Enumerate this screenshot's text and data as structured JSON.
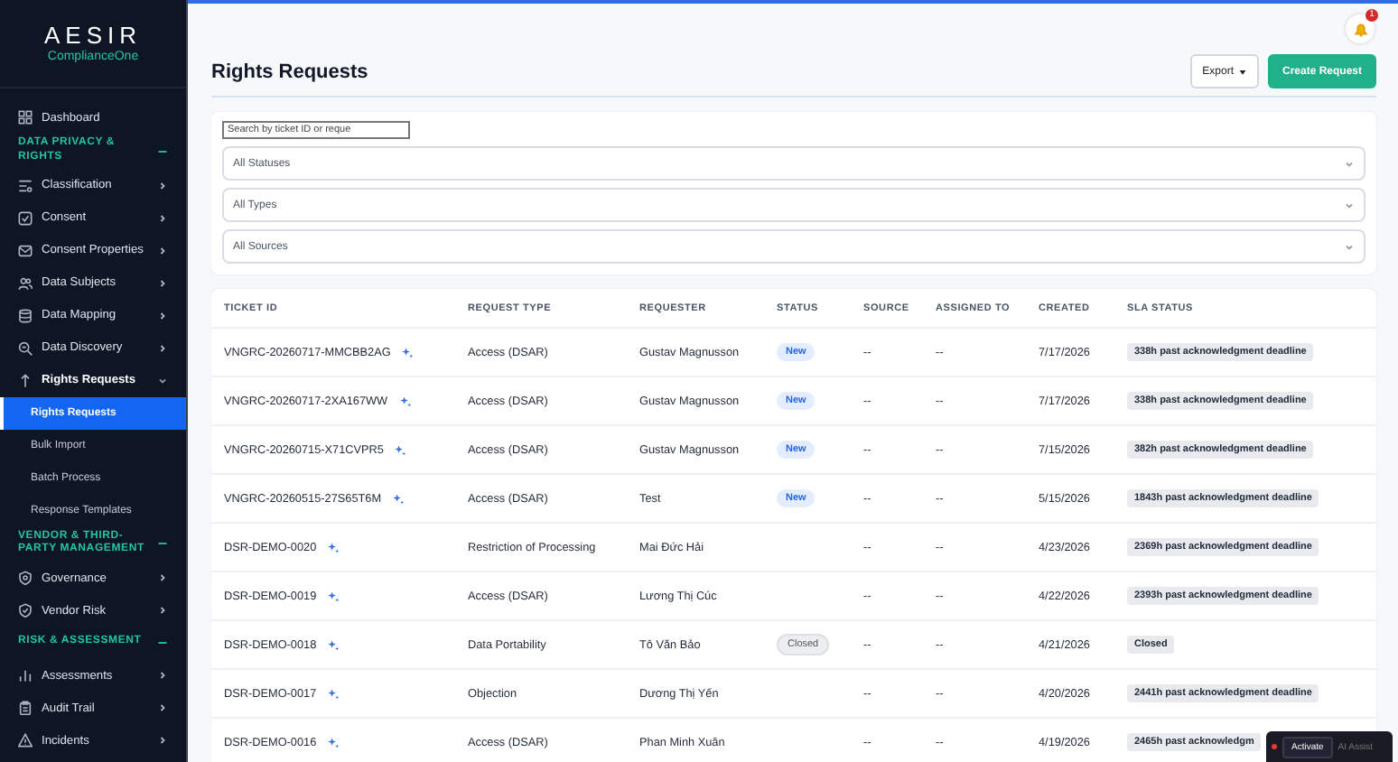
{
  "sidebar": {
    "logo": {
      "brand": "AESIR",
      "product": "ComplianceOne"
    },
    "items": [
      {
        "kind": "link",
        "label": "Dashboard"
      },
      {
        "kind": "section",
        "label": "DATA PRIVACY & RIGHTS",
        "expanded": true
      },
      {
        "kind": "group",
        "label": "Classification",
        "expanded": false
      },
      {
        "kind": "group",
        "label": "Consent",
        "expanded": false
      },
      {
        "kind": "group",
        "label": "Consent Properties",
        "expanded": false
      },
      {
        "kind": "group",
        "label": "Data Subjects",
        "expanded": false
      },
      {
        "kind": "group",
        "label": "Data Mapping",
        "expanded": false
      },
      {
        "kind": "group",
        "label": "Data Discovery",
        "expanded": false
      },
      {
        "kind": "group",
        "label": "Rights Requests",
        "expanded": true
      },
      {
        "kind": "subitem",
        "label": "Rights Requests",
        "selected": true
      },
      {
        "kind": "subitem",
        "label": "Bulk Import",
        "selected": false
      },
      {
        "kind": "subitem",
        "label": "Batch Process",
        "selected": false
      },
      {
        "kind": "subitem",
        "label": "Response Templates",
        "selected": false
      },
      {
        "kind": "section",
        "label": "VENDOR & THIRD-PARTY MANAGEMENT",
        "expanded": true
      },
      {
        "kind": "group",
        "label": "Governance",
        "expanded": false
      },
      {
        "kind": "group",
        "label": "Vendor Risk",
        "expanded": false
      },
      {
        "kind": "section",
        "label": "RISK & ASSESSMENT",
        "expanded": true
      },
      {
        "kind": "group",
        "label": "Assessments",
        "expanded": false
      },
      {
        "kind": "group",
        "label": "Audit Trail",
        "expanded": false
      },
      {
        "kind": "group",
        "label": "Incidents",
        "expanded": false
      }
    ]
  },
  "header": {
    "notification_count": "1",
    "title": "Rights Requests",
    "export_button": "Export",
    "create_button": "Create Request"
  },
  "filters": {
    "search": {
      "placeholder": "Search by ticket ID or reque"
    },
    "selects": [
      "All Statuses",
      "All Types",
      "All Sources"
    ]
  },
  "table": {
    "columns": [
      "TICKET ID",
      "REQUEST TYPE",
      "REQUESTER",
      "STATUS",
      "SOURCE",
      "ASSIGNED TO",
      "CREATED",
      "SLA STATUS"
    ],
    "rows": [
      {
        "ticket_id": "VNGRC-20260717-MMCBB2AG",
        "request_type": "Access (DSAR)",
        "requester": "Gustav Magnusson",
        "status": {
          "label": "New",
          "kind": "new"
        },
        "source": "--",
        "assigned_to": "--",
        "created": "7/17/2026",
        "sla": "338h past acknowledgment deadline"
      },
      {
        "ticket_id": "VNGRC-20260717-2XA167WW",
        "request_type": "Access (DSAR)",
        "requester": "Gustav Magnusson",
        "status": {
          "label": "New",
          "kind": "new"
        },
        "source": "--",
        "assigned_to": "--",
        "created": "7/17/2026",
        "sla": "338h past acknowledgment deadline"
      },
      {
        "ticket_id": "VNGRC-20260715-X71CVPR5",
        "request_type": "Access (DSAR)",
        "requester": "Gustav Magnusson",
        "status": {
          "label": "New",
          "kind": "new"
        },
        "source": "--",
        "assigned_to": "--",
        "created": "7/15/2026",
        "sla": "382h past acknowledgment deadline"
      },
      {
        "ticket_id": "VNGRC-20260515-27S65T6M",
        "request_type": "Access (DSAR)",
        "requester": "Test",
        "status": {
          "label": "New",
          "kind": "new"
        },
        "source": "--",
        "assigned_to": "--",
        "created": "5/15/2026",
        "sla": "1843h past acknowledgment deadline"
      },
      {
        "ticket_id": "DSR-DEMO-0020",
        "request_type": "Restriction of Processing",
        "requester": "Mai Đức Hải",
        "source": "--",
        "assigned_to": "--",
        "created": "4/23/2026",
        "sla": "2369h past acknowledgment deadline"
      },
      {
        "ticket_id": "DSR-DEMO-0019",
        "request_type": "Access (DSAR)",
        "requester": "Lương Thị Cúc",
        "source": "--",
        "assigned_to": "--",
        "created": "4/22/2026",
        "sla": "2393h past acknowledgment deadline"
      },
      {
        "ticket_id": "DSR-DEMO-0018",
        "request_type": "Data Portability",
        "requester": "Tô Văn Bảo",
        "status": {
          "label": "Closed",
          "kind": "closed"
        },
        "source": "--",
        "assigned_to": "--",
        "created": "4/21/2026",
        "sla": "Closed"
      },
      {
        "ticket_id": "DSR-DEMO-0017",
        "request_type": "Objection",
        "requester": "Dương Thị Yến",
        "source": "--",
        "assigned_to": "--",
        "created": "4/20/2026",
        "sla": "2441h past acknowledgment deadline"
      },
      {
        "ticket_id": "DSR-DEMO-0016",
        "request_type": "Access (DSAR)",
        "requester": "Phan Minh Xuân",
        "source": "--",
        "assigned_to": "--",
        "created": "4/19/2026",
        "sla": "2465h past acknowledgm"
      }
    ]
  },
  "assistant_widget": {
    "button": "Activate",
    "label": "AI Assist"
  }
}
